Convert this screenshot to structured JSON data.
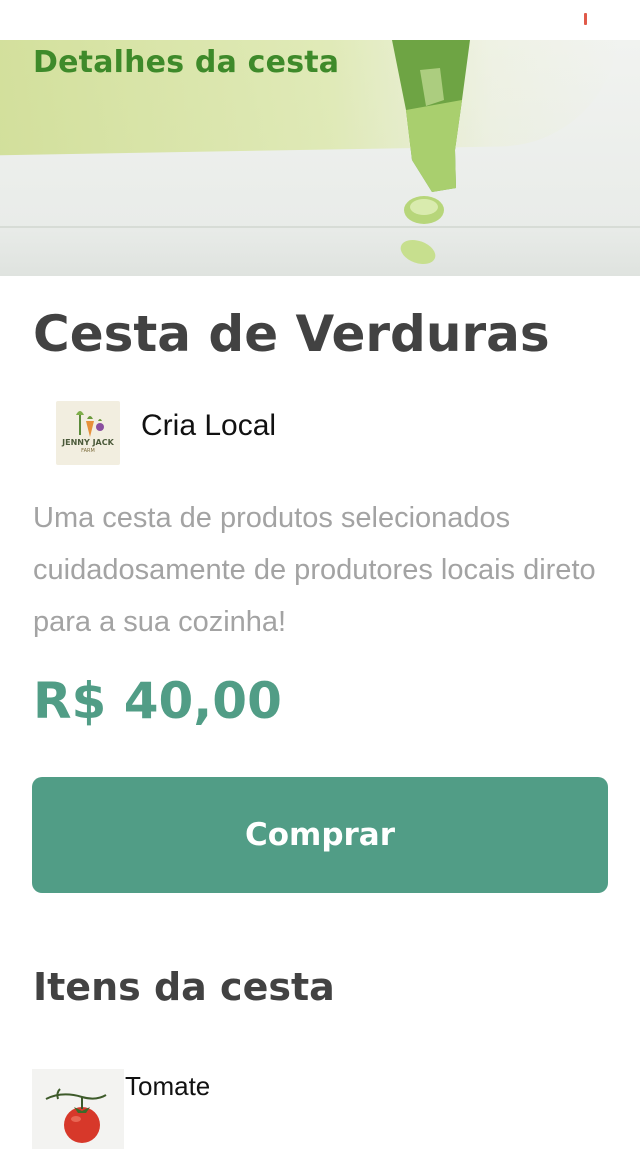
{
  "header": {
    "title": "Detalhes da cesta"
  },
  "product": {
    "title": "Cesta de Verduras",
    "producer": {
      "name": "Cria Local",
      "logo_text": "JENNY JACK",
      "logo_subtext": "FARM"
    },
    "description": "Uma cesta de produtos selecionados cuidadosamente de produtores locais direto para a sua cozinha!",
    "price": "R$ 40,00",
    "buy_label": "Comprar"
  },
  "items_section": {
    "title": "Itens da cesta",
    "items": [
      {
        "name": "Tomate"
      }
    ]
  },
  "colors": {
    "accent": "#519d86",
    "header_green": "#3e8a2a",
    "text_dark": "#424242",
    "text_muted": "#a3a3a3"
  }
}
